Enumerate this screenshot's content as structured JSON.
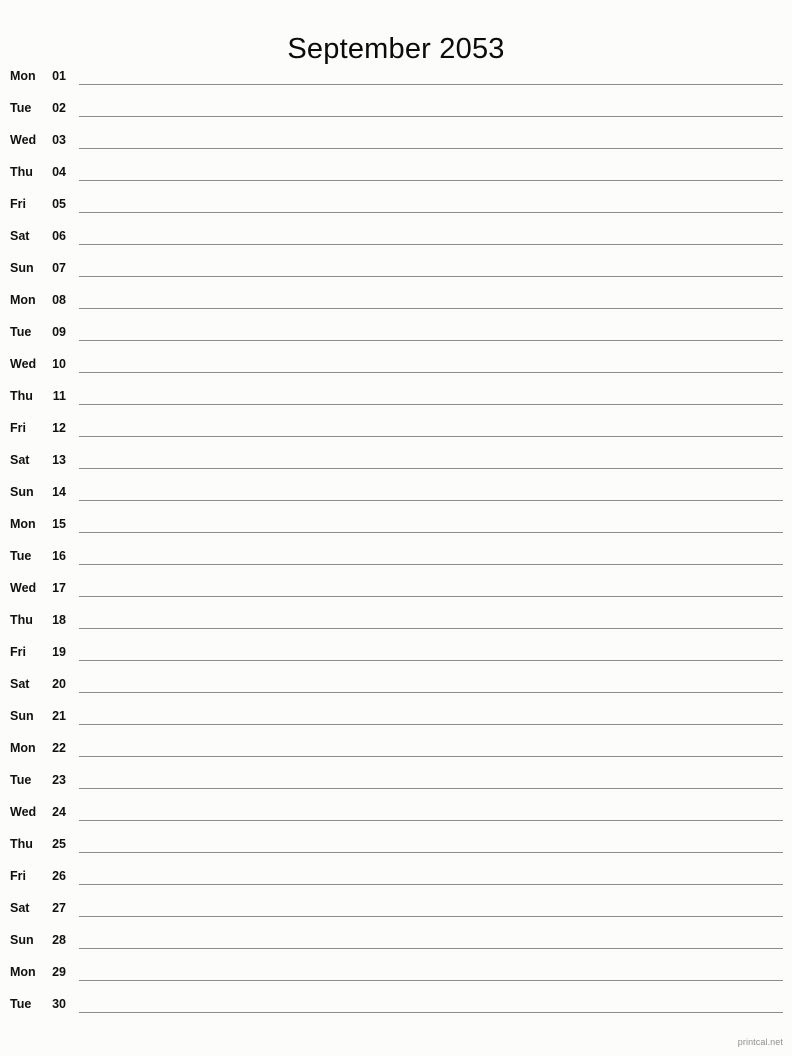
{
  "document": {
    "title": "September 2053",
    "month_name": "September",
    "year": "2053",
    "footer_credit": "printcal.net",
    "background_color": "#fcfcfa",
    "text_color": "#111111",
    "rule_color": "#8d8d8d",
    "footer_color": "#8e8e8e"
  },
  "days": [
    {
      "weekday": "Mon",
      "date": "01"
    },
    {
      "weekday": "Tue",
      "date": "02"
    },
    {
      "weekday": "Wed",
      "date": "03"
    },
    {
      "weekday": "Thu",
      "date": "04"
    },
    {
      "weekday": "Fri",
      "date": "05"
    },
    {
      "weekday": "Sat",
      "date": "06"
    },
    {
      "weekday": "Sun",
      "date": "07"
    },
    {
      "weekday": "Mon",
      "date": "08"
    },
    {
      "weekday": "Tue",
      "date": "09"
    },
    {
      "weekday": "Wed",
      "date": "10"
    },
    {
      "weekday": "Thu",
      "date": "11"
    },
    {
      "weekday": "Fri",
      "date": "12"
    },
    {
      "weekday": "Sat",
      "date": "13"
    },
    {
      "weekday": "Sun",
      "date": "14"
    },
    {
      "weekday": "Mon",
      "date": "15"
    },
    {
      "weekday": "Tue",
      "date": "16"
    },
    {
      "weekday": "Wed",
      "date": "17"
    },
    {
      "weekday": "Thu",
      "date": "18"
    },
    {
      "weekday": "Fri",
      "date": "19"
    },
    {
      "weekday": "Sat",
      "date": "20"
    },
    {
      "weekday": "Sun",
      "date": "21"
    },
    {
      "weekday": "Mon",
      "date": "22"
    },
    {
      "weekday": "Tue",
      "date": "23"
    },
    {
      "weekday": "Wed",
      "date": "24"
    },
    {
      "weekday": "Thu",
      "date": "25"
    },
    {
      "weekday": "Fri",
      "date": "26"
    },
    {
      "weekday": "Sat",
      "date": "27"
    },
    {
      "weekday": "Sun",
      "date": "28"
    },
    {
      "weekday": "Mon",
      "date": "29"
    },
    {
      "weekday": "Tue",
      "date": "30"
    }
  ]
}
